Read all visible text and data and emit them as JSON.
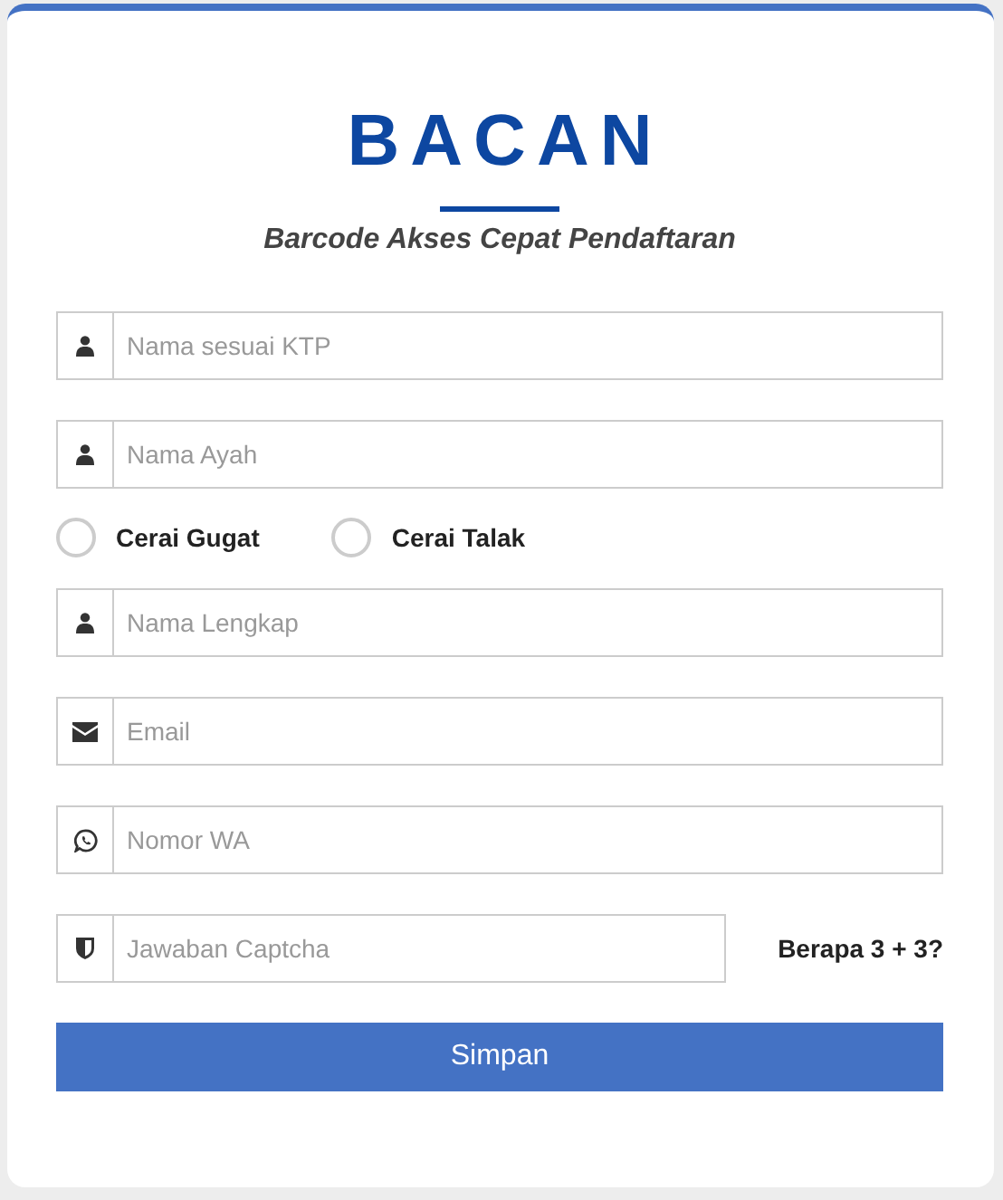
{
  "header": {
    "title": "BACAN",
    "subtitle": "Barcode Akses Cepat Pendaftaran"
  },
  "form": [
    {
      "kind": "name",
      "placeholder": "Nama sesuai KTP"
    },
    {
      "kind": "name",
      "placeholder": "Nama Ayah"
    },
    {
      "kind": "radios",
      "options": [
        {
          "label": "Cerai Gugat",
          "selected": false
        },
        {
          "label": "Cerai Talak",
          "selected": false
        }
      ]
    },
    {
      "kind": "name",
      "placeholder": "Nama Lengkap"
    },
    {
      "kind": "email",
      "placeholder": "Email"
    },
    {
      "kind": "phone",
      "placeholder": "Nomor WA"
    },
    {
      "kind": "captcha",
      "placeholder": "Jawaban Captcha",
      "question": "Berapa 3 + 3?"
    }
  ],
  "submit": "Simpan"
}
